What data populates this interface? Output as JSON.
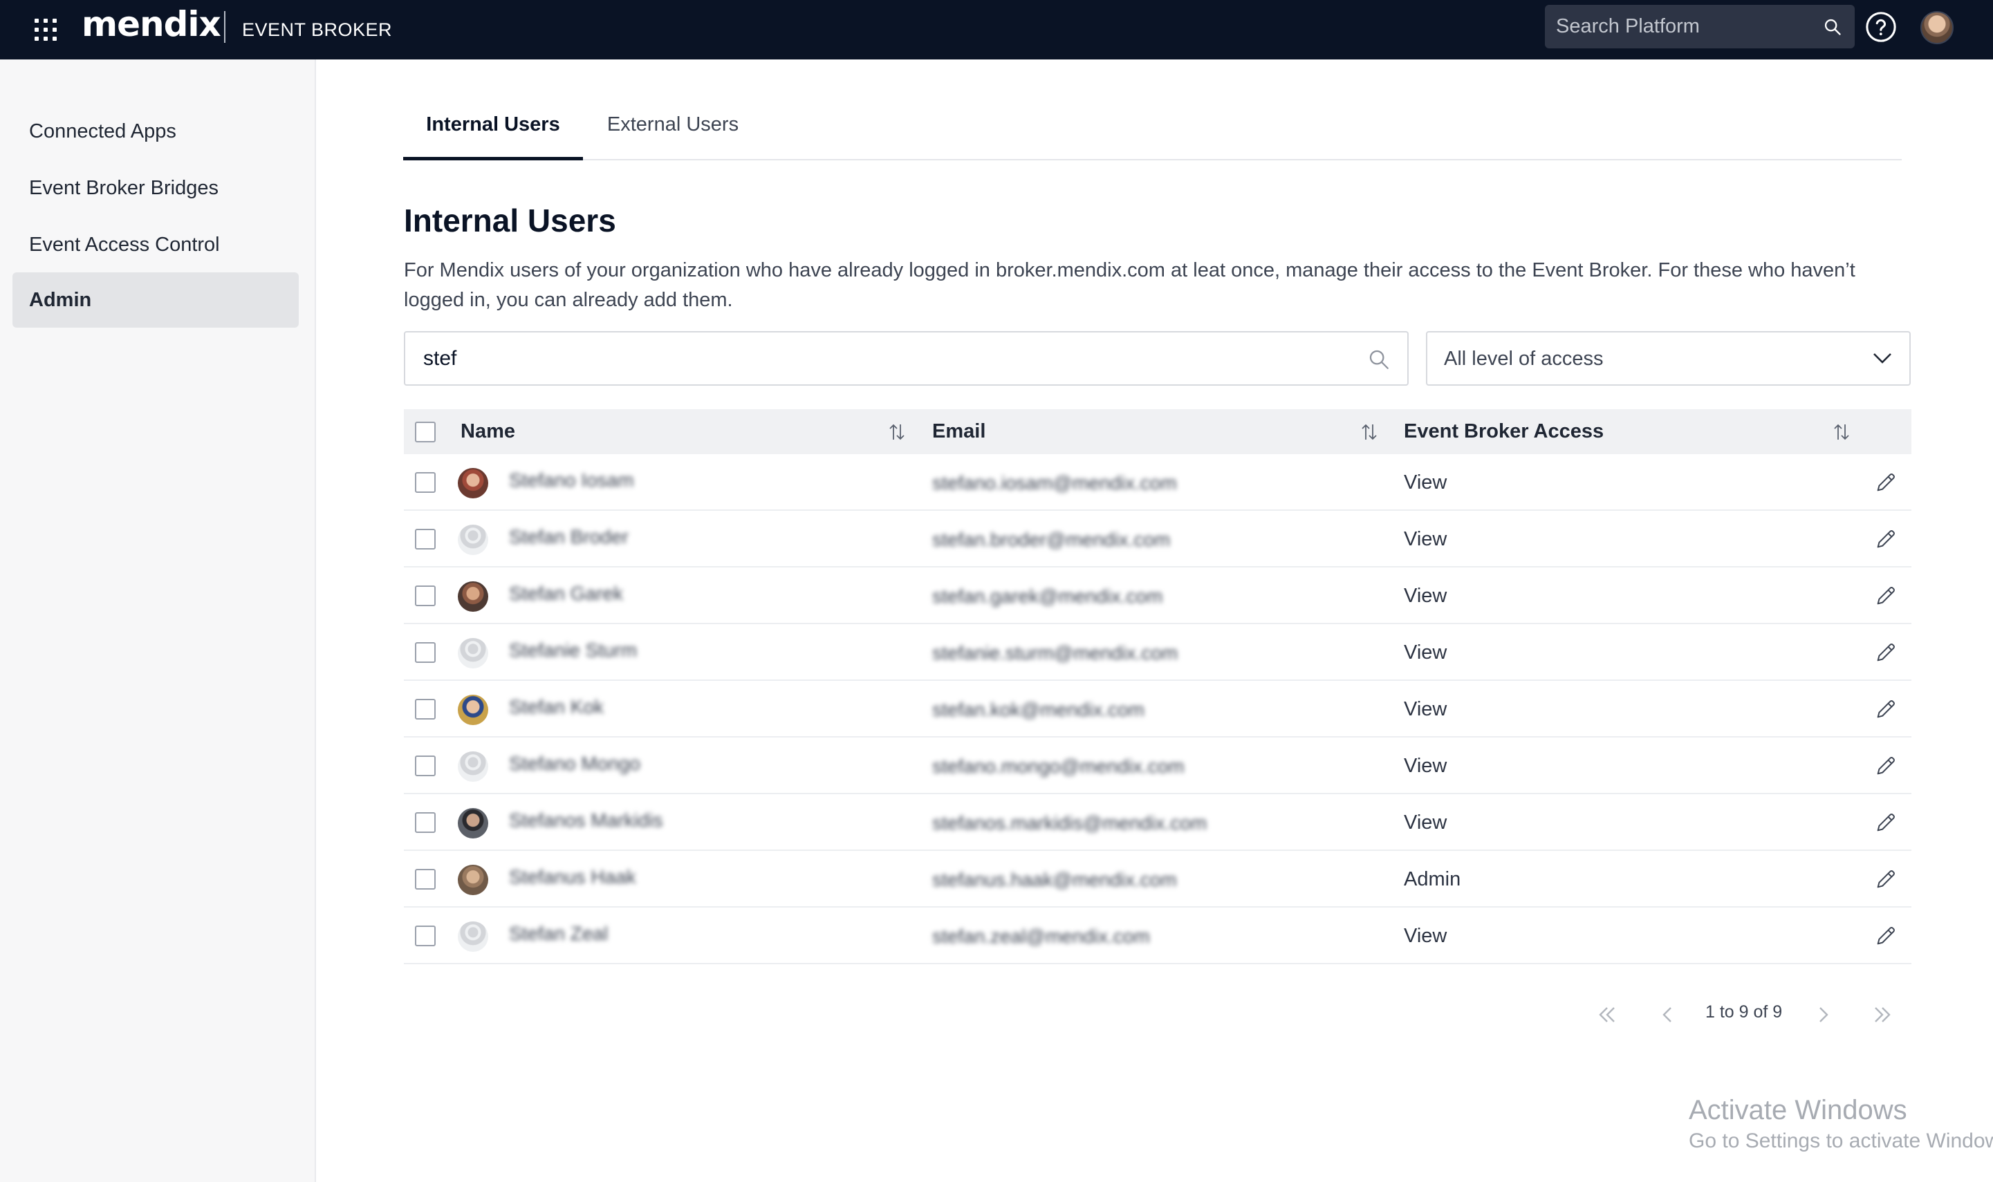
{
  "topbar": {
    "brand": "mendix",
    "product": "EVENT BROKER",
    "search_placeholder": "Search Platform"
  },
  "sidebar": {
    "items": [
      {
        "label": "Connected Apps"
      },
      {
        "label": "Event Broker Bridges"
      },
      {
        "label": "Event Access Control"
      },
      {
        "label": "Admin",
        "active": true
      }
    ]
  },
  "tabs": [
    {
      "label": "Internal Users",
      "active": true
    },
    {
      "label": "External Users"
    }
  ],
  "page": {
    "title": "Internal Users",
    "description": "For Mendix users of your organization who have already logged in broker.mendix.com at leat once, manage their access to the Event Broker. For these who haven’t logged in, you can already add them."
  },
  "filters": {
    "search_value": "stef",
    "access_select": "All level of access"
  },
  "table": {
    "columns": [
      "Name",
      "Email",
      "Event Broker Access"
    ],
    "rows": [
      {
        "name": "Stefano Iosam",
        "email": "stefano.iosam@mendix.com",
        "access": "View",
        "avatar": "photo-red"
      },
      {
        "name": "Stefan Broder",
        "email": "stefan.broder@mendix.com",
        "access": "View",
        "avatar": "placeholder"
      },
      {
        "name": "Stefan Garek",
        "email": "stefan.garek@mendix.com",
        "access": "View",
        "avatar": "photo-brown"
      },
      {
        "name": "Stefanie Sturm",
        "email": "stefanie.sturm@mendix.com",
        "access": "View",
        "avatar": "placeholder"
      },
      {
        "name": "Stefan Kok",
        "email": "stefan.kok@mendix.com",
        "access": "View",
        "avatar": "photo-blue"
      },
      {
        "name": "Stefano Mongo",
        "email": "stefano.mongo@mendix.com",
        "access": "View",
        "avatar": "placeholder"
      },
      {
        "name": "Stefanos Markidis",
        "email": "stefanos.markidis@mendix.com",
        "access": "View",
        "avatar": "photo-dark"
      },
      {
        "name": "Stefanus Haak",
        "email": "stefanus.haak@mendix.com",
        "access": "Admin",
        "avatar": "photo-tan"
      },
      {
        "name": "Stefan Zeal",
        "email": "stefan.zeal@mendix.com",
        "access": "View",
        "avatar": "placeholder"
      }
    ]
  },
  "pagination": {
    "info": "1 to 9 of 9"
  },
  "watermark": {
    "line1": "Activate Windows",
    "line2": "Go to Settings to activate Windows."
  }
}
